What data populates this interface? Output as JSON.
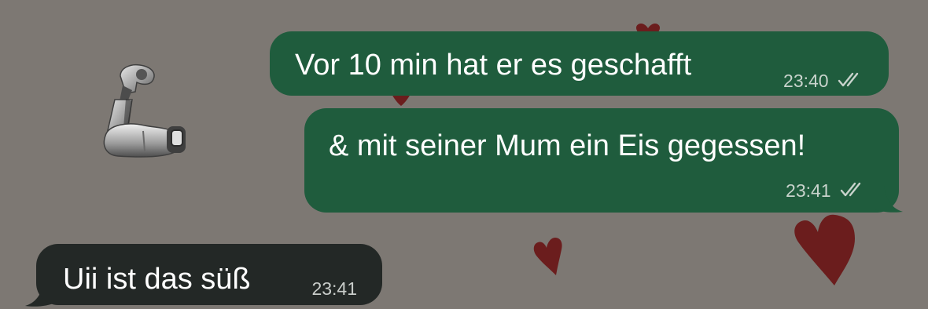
{
  "chat": {
    "background_color": "#7d7873",
    "outgoing_bubble_color": "#1f5c3d",
    "incoming_bubble_color": "#232826"
  },
  "messages": [
    {
      "direction": "outgoing",
      "text": "Vor 10 min hat er es geschafft",
      "time": "23:40",
      "status_icon": "double-check-icon"
    },
    {
      "direction": "outgoing",
      "text": "& mit seiner Mum ein Eis gegessen!",
      "time": "23:41",
      "status_icon": "double-check-icon"
    },
    {
      "direction": "incoming",
      "text": "Uii ist das süß",
      "time": "23:41"
    }
  ],
  "decorations": {
    "sticker": "mechanical-arm-emoji",
    "wallpaper_icon": "heart-icon",
    "heart_color": "#6b1d1d"
  }
}
